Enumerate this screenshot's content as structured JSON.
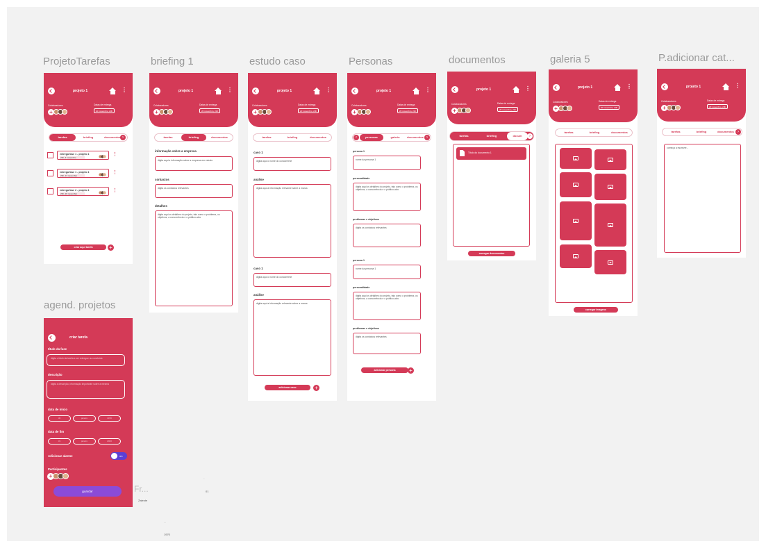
{
  "frames": {
    "tarefas": {
      "title": "ProjetoTarefas",
      "project": "projeto 1",
      "collab_label": "Colaboradores",
      "date_label": "Datas de entrega",
      "date_value": "20 novembro, 23h",
      "tabs": [
        "tarefas",
        "briefing",
        "documentos"
      ],
      "tasks": [
        {
          "title": "entrega fase 1 - projeto 1",
          "date": "23h, 3 novembro"
        },
        {
          "title": "entrega fase 1 - projeto 1",
          "date": "23h, 13 novembro"
        },
        {
          "title": "entrega fase 2 - projeto 1",
          "date": "23h, 20 novembro"
        }
      ],
      "create_button": "criar aqui tarefa"
    },
    "briefing": {
      "title": "briefing 1",
      "project": "projeto 1",
      "collab_label": "Colaboradores",
      "date_label": "Datas de entrega",
      "date_value": "20 novembro, 23h",
      "tabs": [
        "tarefas",
        "briefing",
        "documentos"
      ],
      "sections": [
        {
          "label": "informação sobre a empresa",
          "text": "digita aqui a informação sobre a empresa em estudo"
        },
        {
          "label": "contactos",
          "text": "digita os contactos relevantes"
        },
        {
          "label": "detalhes",
          "text": "digita aqui os detalhes do projeto, tais como o problema, os objetivos, a concorrência e o público-alvo"
        }
      ]
    },
    "estudo": {
      "title": "estudo caso",
      "project": "projeto 1",
      "collab_label": "Colaboradores",
      "date_label": "Datas de entrega",
      "date_value": "20 novembro, 23h",
      "tabs": [
        "tarefas",
        "briefing",
        "documentos"
      ],
      "cases": [
        {
          "label": "caso 1",
          "name_text": "digita aqui o nome do concorrente",
          "analysis_label": "análise",
          "analysis_text": "digita aqui a informação relevante sobre a marca"
        },
        {
          "label": "caso 1",
          "name_text": "digita aqui o nome do concorrente",
          "analysis_label": "análise",
          "analysis_text": "digita aqui a informação relevante sobre a marca"
        }
      ],
      "add_button": "adicionar caso"
    },
    "personas": {
      "title": "Personas",
      "project": "projeto 1",
      "collab_label": "Colaboradores",
      "date_label": "Datas de entrega",
      "date_value": "20 novembro, 23h",
      "tabs": [
        "personas",
        "galeria",
        "documentos"
      ],
      "items": [
        {
          "label": "persona 1",
          "name_text": "nome da persona 1",
          "pers_label": "personalidade",
          "pers_text": "digita aqui os detalhes do projeto, tais como o problema, os objetivos, a concorrência e o público-alvo",
          "prob_label": "problemas e objetivos",
          "prob_text": "digita os contactos relevantes"
        },
        {
          "label": "persona 1",
          "name_text": "nome da persona 1",
          "pers_label": "personalidade",
          "pers_text": "digita aqui os detalhes do projeto, tais como o problema, os objetivos, a concorrência e o público-alvo",
          "prob_label": "problemas e objetivos",
          "prob_text": "digita os contactos relevantes"
        }
      ],
      "add_button": "adicionar persona"
    },
    "documentos": {
      "title": "documentos",
      "project": "projeto 1",
      "collab_label": "Colaboradores",
      "date_label": "Datas de entrega",
      "date_value": "20 novembro, 23h",
      "tabs": [
        "tarefas",
        "briefing",
        "docum"
      ],
      "doc_title": "Título do documento 1",
      "upload_button": "carregar documentos"
    },
    "galeria": {
      "title": "galeria 5",
      "project": "projeto 1",
      "collab_label": "Colaboradores",
      "date_label": "Datas de entrega",
      "date_value": "20 novembro, 23h",
      "tabs": [
        "tarefas",
        "briefing",
        "documentos"
      ],
      "upload_button": "carregar imagens"
    },
    "categoria": {
      "title": "P.adicionar cat...",
      "project": "projeto 1",
      "collab_label": "Colaboradores",
      "date_label": "Datas de entrega",
      "date_value": "20 novembro, 23h",
      "tabs": [
        "tarefas",
        "briefing",
        "documentos"
      ],
      "placeholder": "começa a escrever..."
    },
    "agend": {
      "title": "agend. projetos",
      "heading": "criar tarefa",
      "phase_label": "título da fase",
      "phase_placeholder": "digita o título da tarefa a ser entregue ou concluída",
      "desc_label": "descrição",
      "desc_placeholder": "digita a descrição, informação importante sobre a mesma",
      "start_label": "data de início",
      "start_values": [
        "30",
        "janeiro",
        "1970"
      ],
      "end_label": "data de fim",
      "end_values": [
        "31",
        "janeiro",
        "2023"
      ],
      "alarm_label": "Adicionar alarme",
      "alarm_state": "on",
      "participants_label": "Participantes",
      "save_button": "guardar"
    }
  },
  "ghost": {
    "fr_label": "Fr...",
    "zaleste": "Zaleste",
    "dots1": "...",
    "dots2": "...",
    "val1": "01",
    "val2": "1970"
  },
  "colors": {
    "brand": "#d43a57",
    "save": "#8b4bd8",
    "toggle": "#5b3fd6"
  }
}
